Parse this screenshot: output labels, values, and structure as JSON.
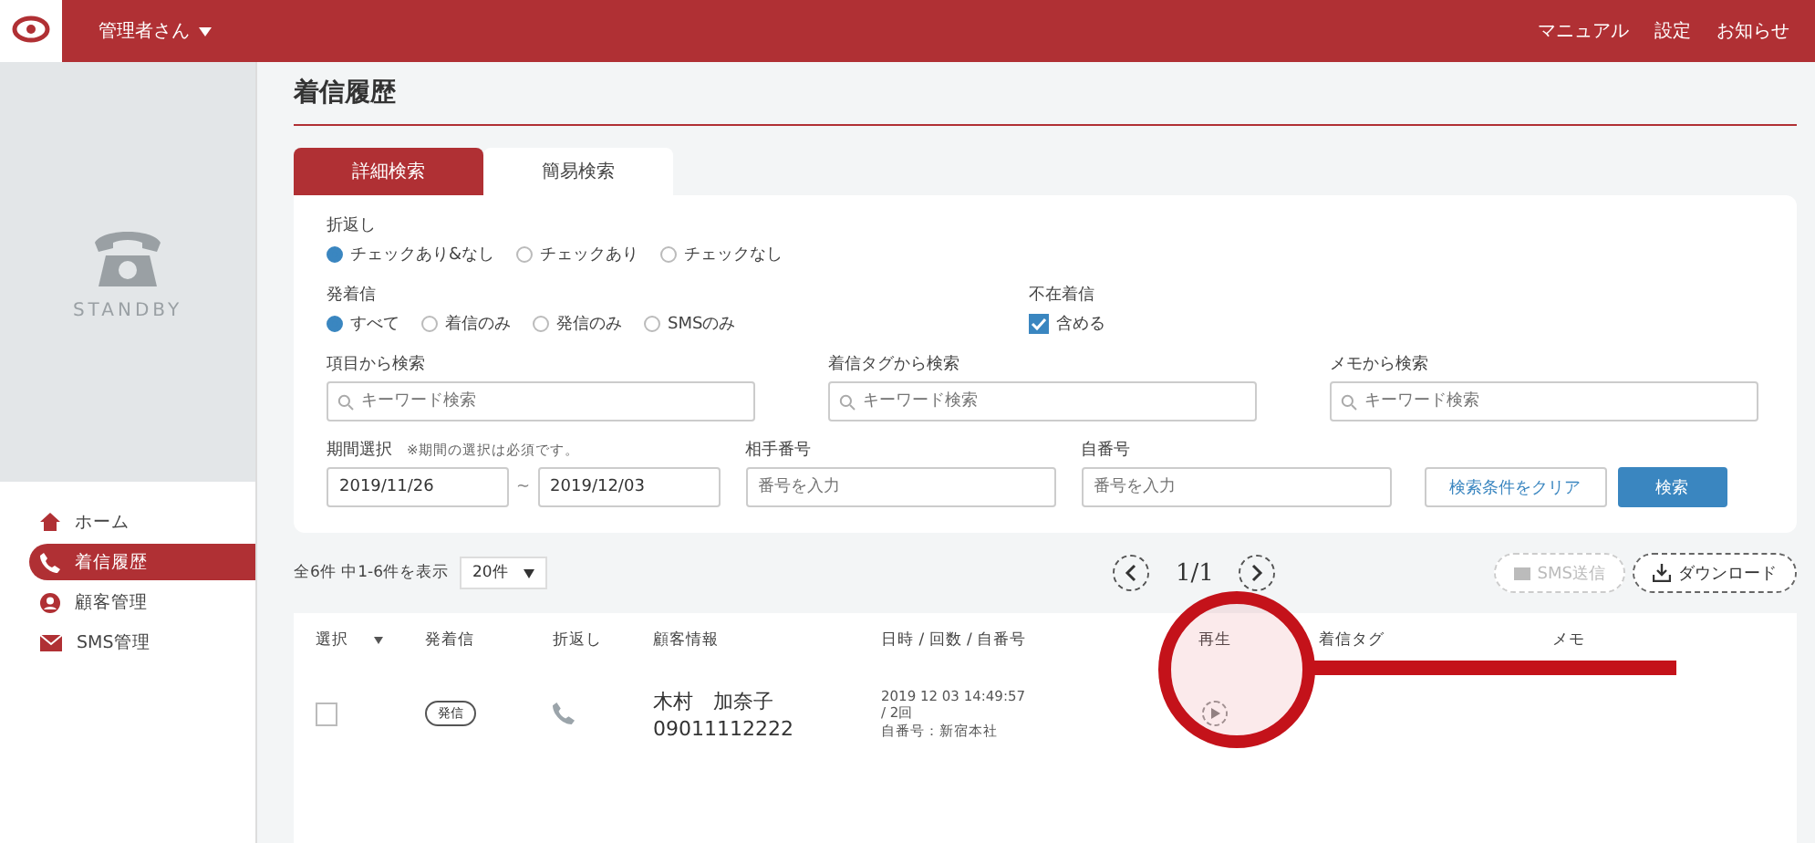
{
  "header": {
    "user": "管理者さん",
    "links": [
      "マニュアル",
      "設定",
      "お知らせ"
    ]
  },
  "sidebar": {
    "status": "STANDBY",
    "items": [
      {
        "label": "ホーム",
        "kind": "home",
        "selected": false
      },
      {
        "label": "着信履歴",
        "kind": "phone",
        "selected": true
      },
      {
        "label": "顧客管理",
        "kind": "person",
        "selected": false
      },
      {
        "label": "SMS管理",
        "kind": "mail",
        "selected": false
      }
    ]
  },
  "page_title": "着信履歴",
  "tabs": [
    {
      "label": "詳細検索",
      "selected": true
    },
    {
      "label": "簡易検索",
      "selected": false
    }
  ],
  "callback": {
    "label": "折返し",
    "options": [
      {
        "label": "チェックあり&なし",
        "selected": true
      },
      {
        "label": "チェックあり",
        "selected": false
      },
      {
        "label": "チェックなし",
        "selected": false
      }
    ]
  },
  "direction": {
    "label": "発着信",
    "options": [
      {
        "label": "すべて",
        "selected": true
      },
      {
        "label": "着信のみ",
        "selected": false
      },
      {
        "label": "発信のみ",
        "selected": false
      },
      {
        "label": "SMSのみ",
        "selected": false
      }
    ]
  },
  "missed": {
    "label": "不在着信",
    "option": "含める",
    "checked": true
  },
  "keyword_searches": [
    {
      "label": "項目から検索",
      "placeholder": "キーワード検索"
    },
    {
      "label": "着信タグから検索",
      "placeholder": "キーワード検索"
    },
    {
      "label": "メモから検索",
      "placeholder": "キーワード検索"
    }
  ],
  "period": {
    "label": "期間選択",
    "note": "※期間の選択は必須です。",
    "from": "2019/11/26",
    "separator": "~",
    "to": "2019/12/03"
  },
  "other_number": {
    "label": "相手番号",
    "placeholder": "番号を入力"
  },
  "own_number": {
    "label": "自番号",
    "placeholder": "番号を入力"
  },
  "clear_button": "検索条件をクリア",
  "search_button": "検索",
  "results": {
    "summary": "全6件 中1-6件を表示",
    "per_page": "20件",
    "page": "1/1",
    "sms_button": {
      "label": "SMS送信",
      "disabled": true
    },
    "download_button": "ダウンロード"
  },
  "table": {
    "columns": [
      "選択",
      "発着信",
      "折返し",
      "顧客情報",
      "日時 / 回数 / 自番号",
      "再生",
      "着信タグ",
      "メモ"
    ],
    "rows": [
      {
        "selected": false,
        "direction": "発信",
        "name": "木村　加奈子",
        "number": "09011112222",
        "datetime": "2019 12 03 14:49:57",
        "count": "/ 2回",
        "own": "自番号：新宿本社"
      }
    ]
  }
}
